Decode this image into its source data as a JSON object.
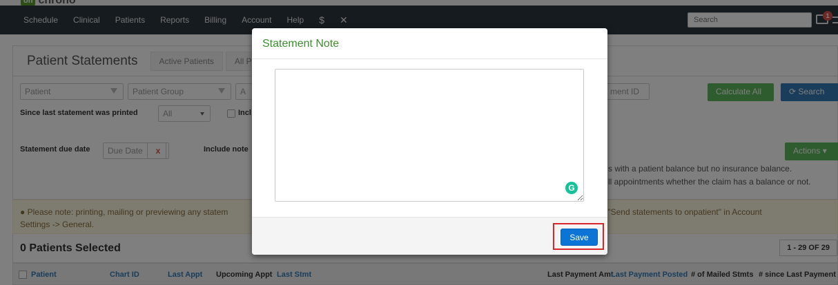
{
  "app": {
    "logo_badge": "on",
    "logo_word": "chrono"
  },
  "nav": {
    "items": [
      "Schedule",
      "Clinical",
      "Patients",
      "Reports",
      "Billing",
      "Account",
      "Help"
    ],
    "search_placeholder": "Search",
    "mail_count": "1"
  },
  "page": {
    "title": "Patient Statements",
    "tabs": [
      "Active Patients",
      "All P"
    ]
  },
  "filters": {
    "patient_placeholder": "Patient",
    "patient_group_placeholder": "Patient Group",
    "third_select": "A",
    "statement_id_fragment": "ment ID",
    "calculate_all": "Calculate All",
    "search": "Search",
    "since_label": "Since last statement was printed",
    "since_value": "All",
    "include_fragment": "Incl",
    "due_label": "Statement due date",
    "due_placeholder": "Due Date",
    "clear": "x",
    "include_note_fragment": "Include note",
    "actions": "Actions",
    "note1": "s with a patient balance but no insurance balance.",
    "note2": "ll appointments whether the claim has a balance or not."
  },
  "alert": {
    "line1_left": "Please note: printing, mailing or previewing any statem",
    "line1_right": "ck \"Send statements to onpatient\" in Account",
    "line2": "Settings -> General."
  },
  "selection": {
    "title": "0 Patients Selected",
    "pager": "1 - 29 OF 29"
  },
  "table": {
    "headers": [
      "Patient",
      "Chart ID",
      "Last Appt",
      "Upcoming Appt",
      "Last Stmt",
      "Last Payment Amt",
      "Last Payment Posted",
      "# of Mailed Stmts",
      "# since Last Payment"
    ]
  },
  "modal": {
    "title": "Statement Note",
    "textarea_value": "",
    "save_label": "Save"
  },
  "colors": {
    "nav_bg": "#2d3640",
    "modal_title": "#3b8f2d",
    "save_btn": "#0b74d5",
    "highlight": "#d9262b"
  }
}
